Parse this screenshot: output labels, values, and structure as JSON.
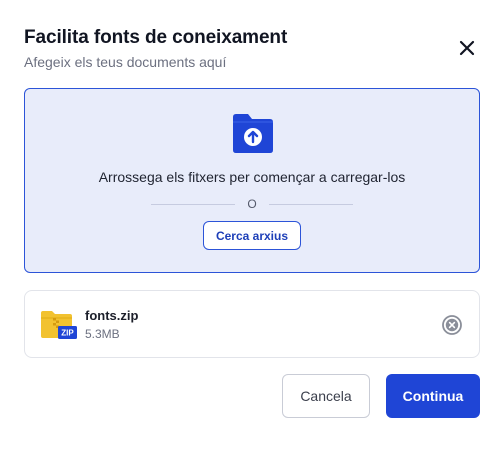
{
  "dialog": {
    "title": "Facilita fonts de coneixament",
    "subtitle": "Afegeix els teus documents aquí",
    "close_icon": "close-icon"
  },
  "dropzone": {
    "icon": "folder-upload-icon",
    "instruction": "Arrossega els fitxers per començar a carregar-los",
    "divider_text": "O",
    "browse_label": "Cerca arxius",
    "accent_color": "#2c54d8",
    "background_color": "#e8ecfa"
  },
  "file": {
    "icon": "zip-file-icon",
    "icon_badge": "ZIP",
    "name": "fonts.zip",
    "size": "5.3MB",
    "remove_icon": "remove-circle-icon"
  },
  "footer": {
    "cancel_label": "Cancela",
    "continue_label": "Continua",
    "primary_color": "#1f45d6"
  }
}
